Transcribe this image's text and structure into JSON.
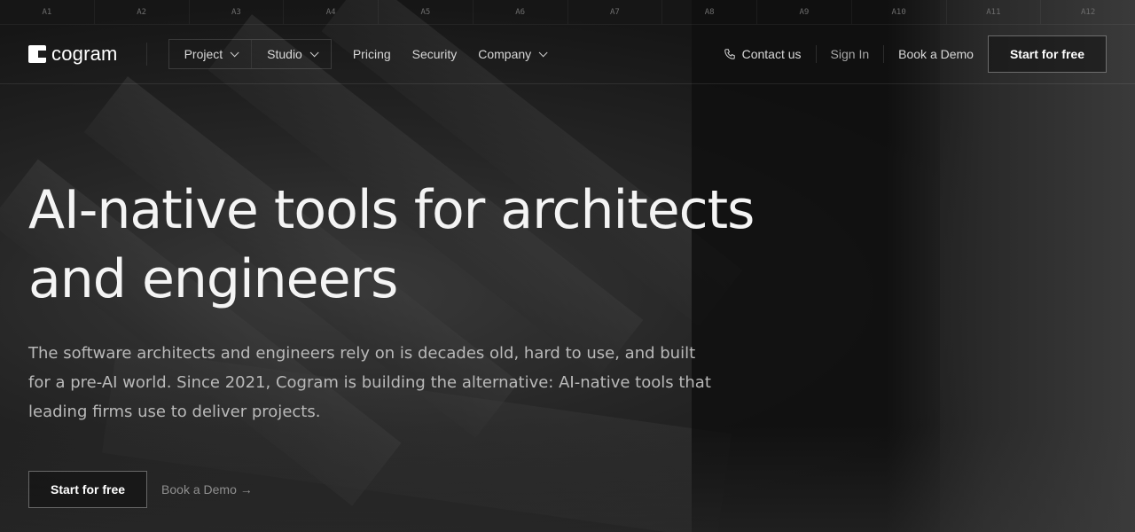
{
  "ruler": [
    "A1",
    "A2",
    "A3",
    "A4",
    "A5",
    "A6",
    "A7",
    "A8",
    "A9",
    "A10",
    "A11",
    "A12"
  ],
  "logo": {
    "text": "cogram"
  },
  "nav": {
    "dropdowns": [
      {
        "label": "Project"
      },
      {
        "label": "Studio"
      }
    ],
    "links": [
      {
        "label": "Pricing"
      },
      {
        "label": "Security"
      },
      {
        "label": "Company",
        "has_dropdown": true
      }
    ],
    "contact_label": "Contact us",
    "signin_label": "Sign In",
    "book_demo_label": "Book a Demo",
    "start_label": "Start for free"
  },
  "hero": {
    "title_line1": "AI-native tools for architects",
    "title_line2": "and engineers",
    "description": "The software architects and engineers rely on is decades old, hard to use, and built for a pre-AI world. Since 2021, Cogram is building the alternative: AI-native tools that leading firms use to deliver projects.",
    "cta_primary": "Start for free",
    "cta_secondary": "Book a Demo →"
  }
}
